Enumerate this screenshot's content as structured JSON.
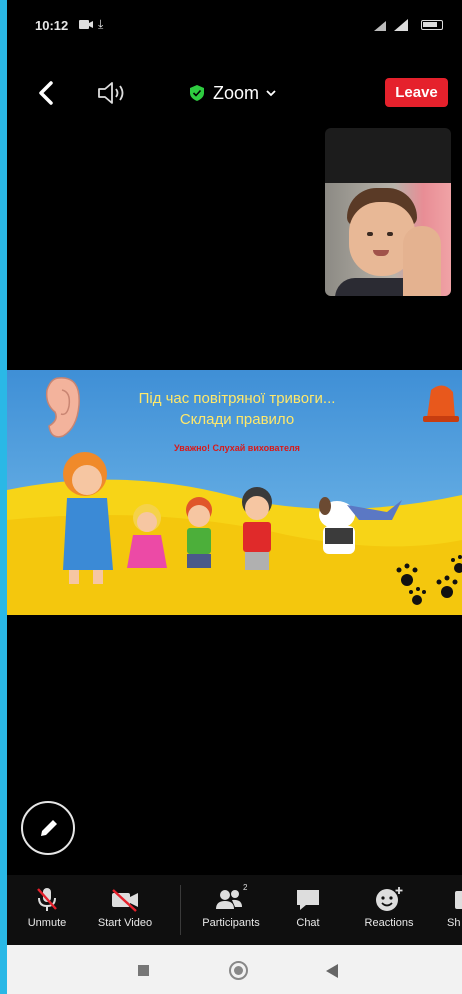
{
  "status_bar": {
    "time": "10:12"
  },
  "top_bar": {
    "meeting_title": "Zoom",
    "leave_label": "Leave"
  },
  "shared_content": {
    "title_line1": "Під час повітряної тривоги...",
    "title_line2": "Склади правило",
    "subtitle": "Уважно! Слухай вихователя"
  },
  "toolbar": {
    "items": [
      {
        "label": "Unmute",
        "icon": "mic-muted-icon"
      },
      {
        "label": "Start Video",
        "icon": "video-off-icon"
      },
      {
        "label": "Participants",
        "icon": "participants-icon",
        "count": "2"
      },
      {
        "label": "Chat",
        "icon": "chat-icon"
      },
      {
        "label": "Reactions",
        "icon": "reactions-icon"
      },
      {
        "label": "Sh",
        "icon": "share-icon"
      }
    ]
  },
  "colors": {
    "leave": "#e5212c",
    "shield": "#2ecc40",
    "side_bars": "#2ab8e6"
  }
}
